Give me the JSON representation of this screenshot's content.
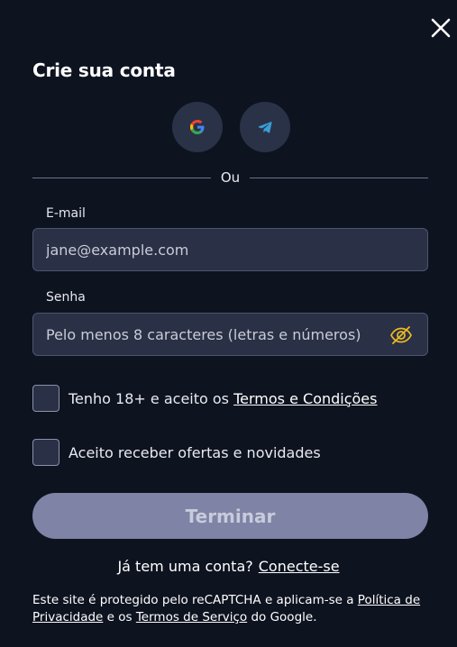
{
  "modal": {
    "title": "Crie sua conta",
    "divider_text": "Ou",
    "email_label": "E-mail",
    "email_placeholder": "jane@example.com",
    "password_label": "Senha",
    "password_placeholder": "Pelo menos 8 caracteres (letras e números)",
    "terms_prefix": "Tenho 18+ e aceito os ",
    "terms_link": "Termos e Condições",
    "offers_label": "Aceito receber ofertas e novidades",
    "submit_label": "Terminar",
    "have_account": "Já tem uma conta?",
    "login_link": "Conecte-se",
    "recaptcha_part1": "Este site é protegido pelo reCAPTCHA e aplicam-se a ",
    "recaptcha_privacy_link": "Política de Privacidade",
    "recaptcha_part2": " e os ",
    "recaptcha_terms_link": "Termos de Serviço",
    "recaptcha_part3": " do Google."
  },
  "icons": {
    "close": "close-icon",
    "google": "google-icon",
    "telegram": "telegram-icon",
    "eye_hidden": "eye-off-icon"
  },
  "colors": {
    "background": "#0e1320",
    "input_bg": "#2a3045",
    "social_bg": "#2a3247",
    "submit_bg": "#7f83a6",
    "eye_icon": "#e8b923"
  }
}
